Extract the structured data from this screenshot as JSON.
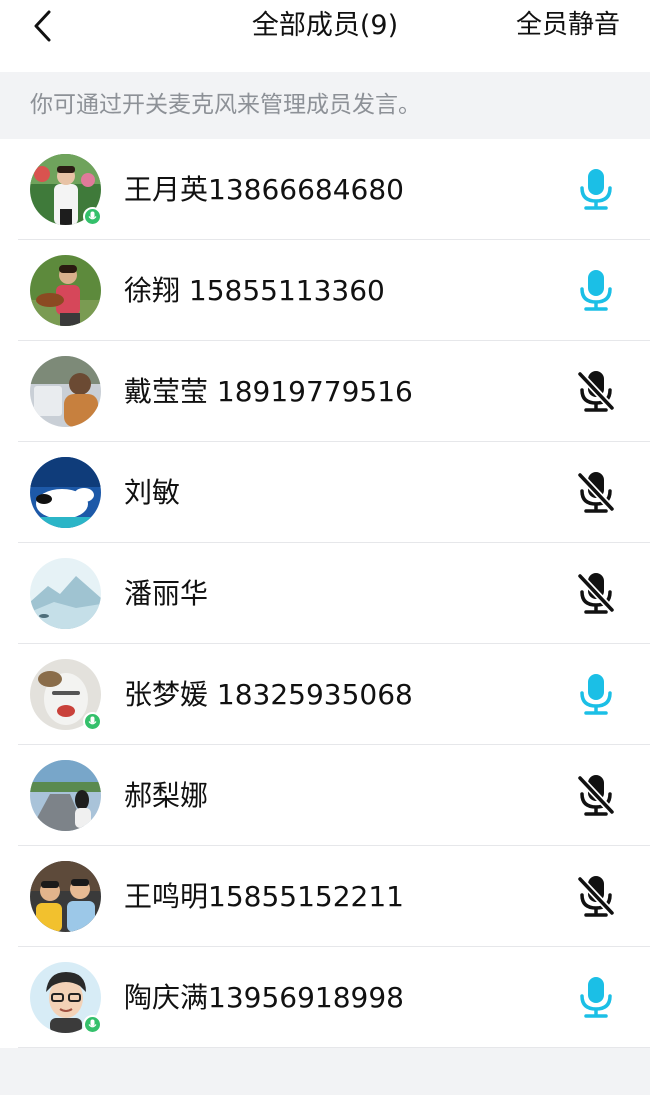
{
  "header": {
    "title": "全部成员(9)",
    "mute_all_label": "全员静音"
  },
  "hint": "你可通过开关麦克风来管理成员发言。",
  "colors": {
    "mic_on": "#1bbfe6",
    "mic_off": "#111111",
    "speaking_badge": "#34c06b"
  },
  "members": [
    {
      "name": "王月英13866684680",
      "mic": "on",
      "speaking": true
    },
    {
      "name": "徐翔 15855113360",
      "mic": "on",
      "speaking": false
    },
    {
      "name": "戴莹莹 18919779516",
      "mic": "off",
      "speaking": false
    },
    {
      "name": "刘敏",
      "mic": "off",
      "speaking": false
    },
    {
      "name": "潘丽华",
      "mic": "off",
      "speaking": false
    },
    {
      "name": "张梦媛 18325935068",
      "mic": "on",
      "speaking": true
    },
    {
      "name": "郝梨娜",
      "mic": "off",
      "speaking": false
    },
    {
      "name": "王鸣明15855152211",
      "mic": "off",
      "speaking": false
    },
    {
      "name": "陶庆满13956918998",
      "mic": "on",
      "speaking": true
    }
  ]
}
